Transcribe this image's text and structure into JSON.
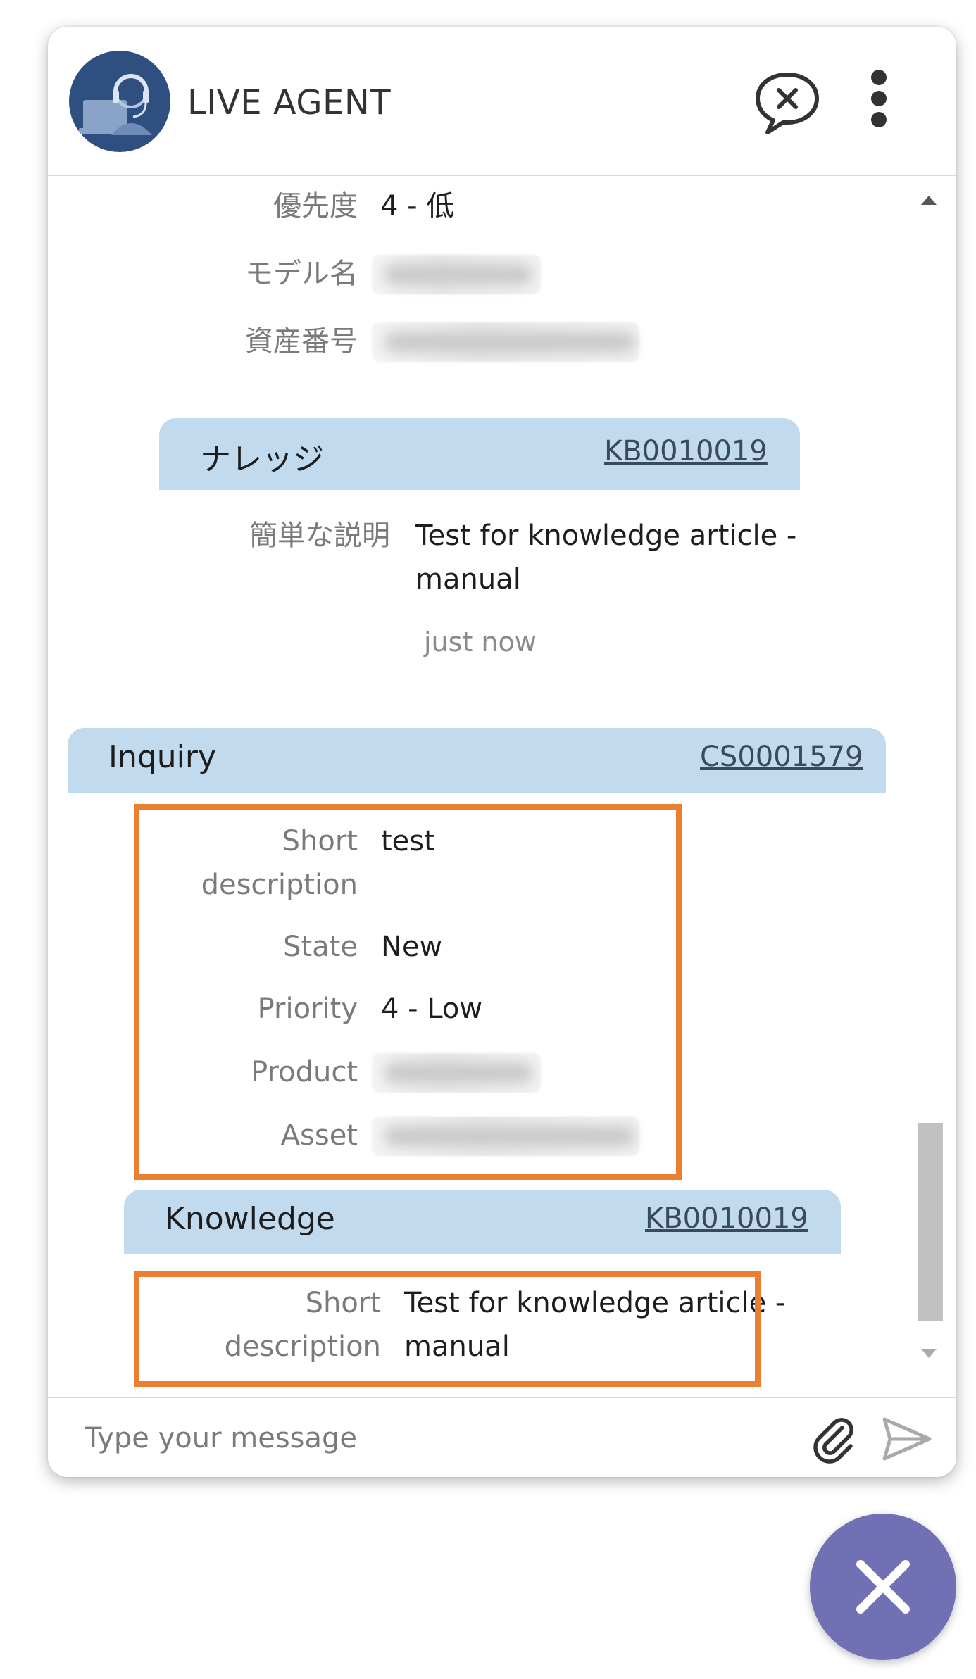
{
  "header": {
    "title": "LIVE AGENT"
  },
  "jp_fields": [
    {
      "label": "優先度",
      "value": "4 - 低"
    },
    {
      "label": "モデル名",
      "value": ""
    },
    {
      "label": "資産番号",
      "value": ""
    }
  ],
  "jp_knowledge": {
    "title": "ナレッジ",
    "number": "KB0010019",
    "field_label": "簡単な説明",
    "value_line1": "Test for knowledge article -",
    "value_line2": "manual",
    "time": "just now"
  },
  "inquiry": {
    "title": "Inquiry",
    "number": "CS0001579",
    "fields": [
      {
        "label_line1": "Short",
        "label_line2": "description",
        "value": "test"
      },
      {
        "label": "State",
        "value": "New"
      },
      {
        "label": "Priority",
        "value": "4 - Low"
      },
      {
        "label": "Product",
        "value": ""
      },
      {
        "label": "Asset",
        "value": ""
      }
    ]
  },
  "knowledge": {
    "title": "Knowledge",
    "number": "KB0010019",
    "label_line1": "Short",
    "label_line2": "description",
    "value_line1": "Test for knowledge article -",
    "value_line2": "manual"
  },
  "composer": {
    "placeholder": "Type your message"
  },
  "colors": {
    "card_header": "#c2daed",
    "highlight": "#ed7d31",
    "fab": "#7270b5"
  },
  "icons": [
    "headset-agent-avatar",
    "end-chat-icon",
    "more-vertical-icon",
    "paperclip-icon",
    "send-icon",
    "close-icon"
  ]
}
